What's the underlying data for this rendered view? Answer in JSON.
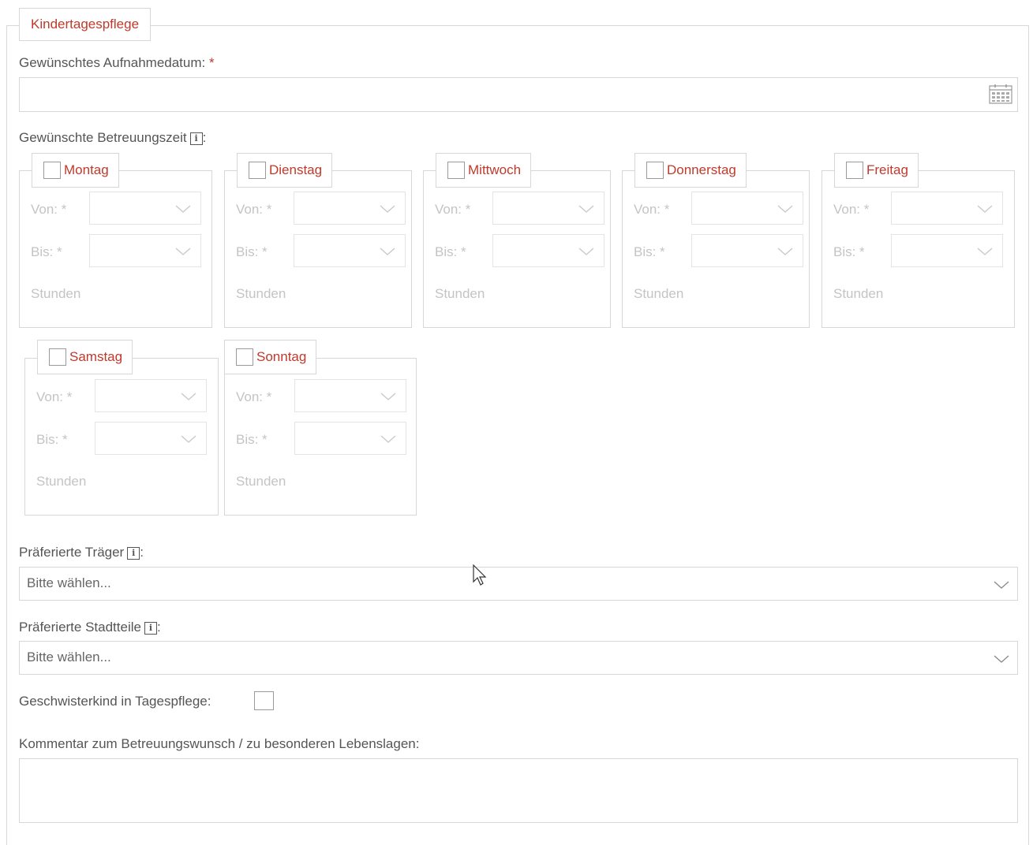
{
  "section": {
    "title": "Kindertagespflege"
  },
  "date_field": {
    "label": "Gewünschtes Aufnahmedatum:",
    "required_mark": "*",
    "value": "",
    "icon": "calendar-icon"
  },
  "care_time": {
    "label": "Gewünschte Betreuungszeit",
    "info_icon": "i",
    "suffix": ":",
    "from_label": "Von: *",
    "to_label": "Bis: *",
    "hours_label": "Stunden",
    "days": [
      {
        "name": "Montag",
        "checked": false
      },
      {
        "name": "Dienstag",
        "checked": false
      },
      {
        "name": "Mittwoch",
        "checked": false
      },
      {
        "name": "Donnerstag",
        "checked": false
      },
      {
        "name": "Freitag",
        "checked": false
      },
      {
        "name": "Samstag",
        "checked": false
      },
      {
        "name": "Sonntag",
        "checked": false
      }
    ]
  },
  "provider": {
    "label": "Präferierte Träger",
    "info_icon": "i",
    "suffix": ":",
    "placeholder": "Bitte wählen..."
  },
  "districts": {
    "label": "Präferierte Stadtteile",
    "info_icon": "i",
    "suffix": ":",
    "placeholder": "Bitte wählen..."
  },
  "sibling": {
    "label": "Geschwisterkind in Tagespflege:",
    "checked": false
  },
  "comment": {
    "label": "Kommentar zum Betreuungswunsch / zu besonderen Lebenslagen:",
    "value": ""
  },
  "colors": {
    "accent": "#c0392b",
    "border": "#d7d7d7",
    "text": "#555555",
    "disabled_text": "#c4c4c4"
  }
}
